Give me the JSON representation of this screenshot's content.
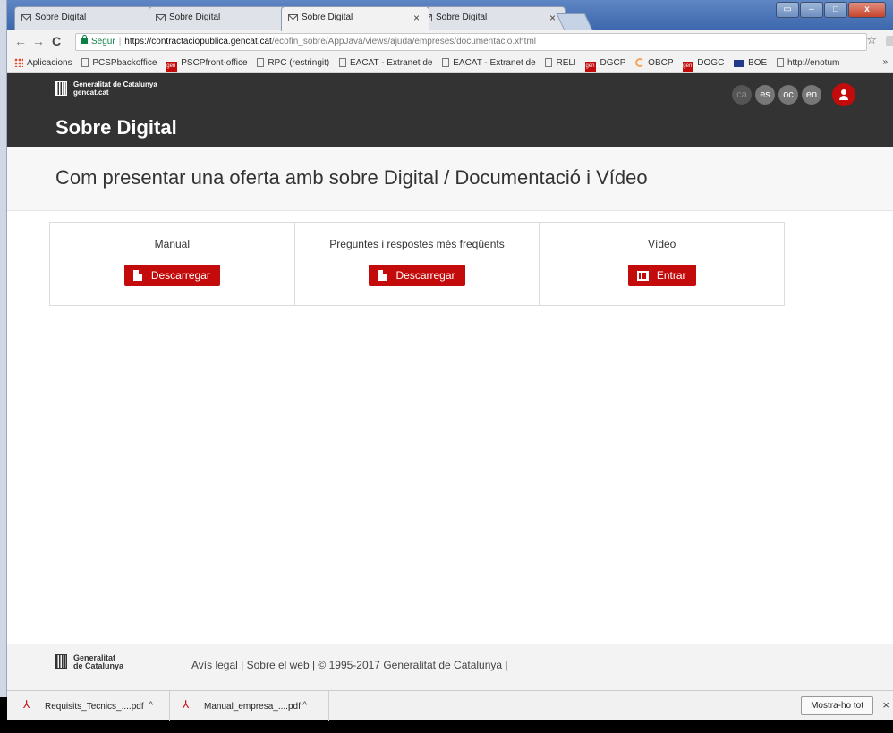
{
  "browser": {
    "tabs": [
      {
        "label": "Sobre Digital",
        "close": "×"
      },
      {
        "label": "Sobre Digital",
        "close": "×"
      },
      {
        "label": "Sobre Digital",
        "close": "×"
      },
      {
        "label": "Sobre Digital",
        "close": "×"
      }
    ],
    "active_tab": 2,
    "secure_label": "Segur",
    "url_host": "https://contractaciopublica.gencat.cat",
    "url_path": "/ecofin_sobre/AppJava/views/ajuda/empreses/documentacio.xhtml",
    "bookmarks": [
      {
        "label": "Aplicacions",
        "icon": "apps-icon"
      },
      {
        "label": "PCSPbackoffice",
        "icon": "page-icon"
      },
      {
        "label": "PSCPfront-office",
        "icon": "gencat-icon"
      },
      {
        "label": "RPC (restringit)",
        "icon": "page-icon"
      },
      {
        "label": "EACAT - Extranet de",
        "icon": "page-icon"
      },
      {
        "label": "EACAT - Extranet de",
        "icon": "page-icon"
      },
      {
        "label": "RELI",
        "icon": "page-icon"
      },
      {
        "label": "DGCP",
        "icon": "gencat-icon"
      },
      {
        "label": "OBCP",
        "icon": "c-icon"
      },
      {
        "label": "DOGC",
        "icon": "gencat-icon"
      },
      {
        "label": "BOE",
        "icon": "boe-icon"
      },
      {
        "label": "http://enotum",
        "icon": "page-icon"
      }
    ],
    "bookmarks_more": "»",
    "gencat_badge": "gen cat"
  },
  "site": {
    "brand_line1": "Generalitat de Catalunya",
    "brand_line2": "gencat.cat",
    "title": "Sobre Digital",
    "languages": [
      "ca",
      "es",
      "oc",
      "en"
    ],
    "current_language": "ca"
  },
  "main": {
    "heading": "Com presentar una oferta amb sobre Digital / Documentació i Vídeo",
    "cards": [
      {
        "title": "Manual",
        "button": "Descarregar",
        "icon": "document-icon"
      },
      {
        "title": "Preguntes i respostes més freqüents",
        "button": "Descarregar",
        "icon": "document-icon"
      },
      {
        "title": "Vídeo",
        "button": "Entrar",
        "icon": "film-icon"
      }
    ]
  },
  "footer": {
    "brand_line1": "Generalitat",
    "brand_line2": "de Catalunya",
    "links": "Avís legal | Sobre el web | © 1995-2017 Generalitat de Catalunya |"
  },
  "downloads": {
    "items": [
      {
        "name": "Requisits_Tecnics_....pdf",
        "caret": "^"
      },
      {
        "name": "Manual_empresa_....pdf",
        "caret": "^"
      }
    ],
    "show_all": "Mostra-ho tot",
    "close": "×"
  },
  "colors": {
    "accent": "#c30b0b",
    "header_bg": "#333333",
    "tabstrip": "#4a73b5"
  }
}
